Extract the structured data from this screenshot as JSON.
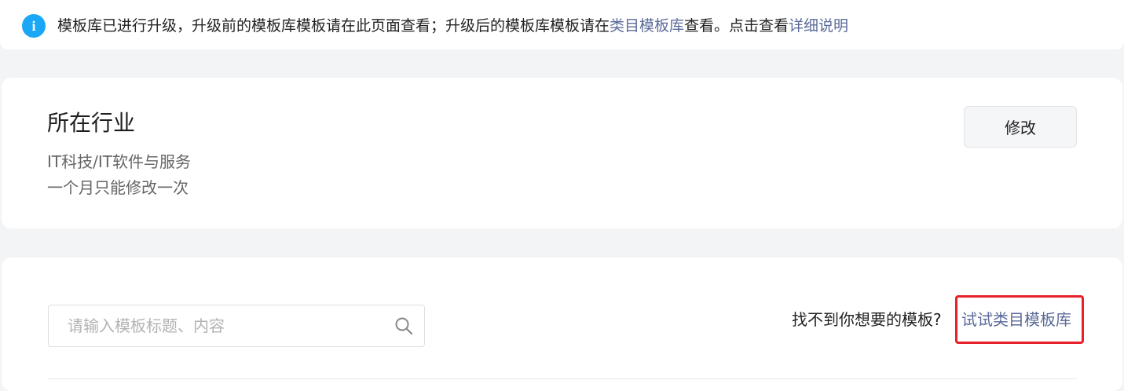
{
  "notice": {
    "icon": "info-icon",
    "icon_glyph": "i",
    "text_part1": "模板库已进行升级，升级前的模板库模板请在此页面查看；升级后的模板库模板请在",
    "link_category_library": "类目模板库",
    "text_part2": "查看。点击查看",
    "link_details": "详细说明"
  },
  "industry": {
    "title": "所在行业",
    "value": "IT科技/IT软件与服务",
    "hint": "一个月只能修改一次",
    "modify_label": "修改"
  },
  "templates": {
    "search_placeholder": "请输入模板标题、内容",
    "search_value": "",
    "cant_find_text": "找不到你想要的模板?",
    "try_link_label": "试试类目模板库"
  },
  "colors": {
    "accent_link": "#5b6a9a",
    "info_blue": "#1aa7f5",
    "highlight_red": "#e8202a"
  }
}
